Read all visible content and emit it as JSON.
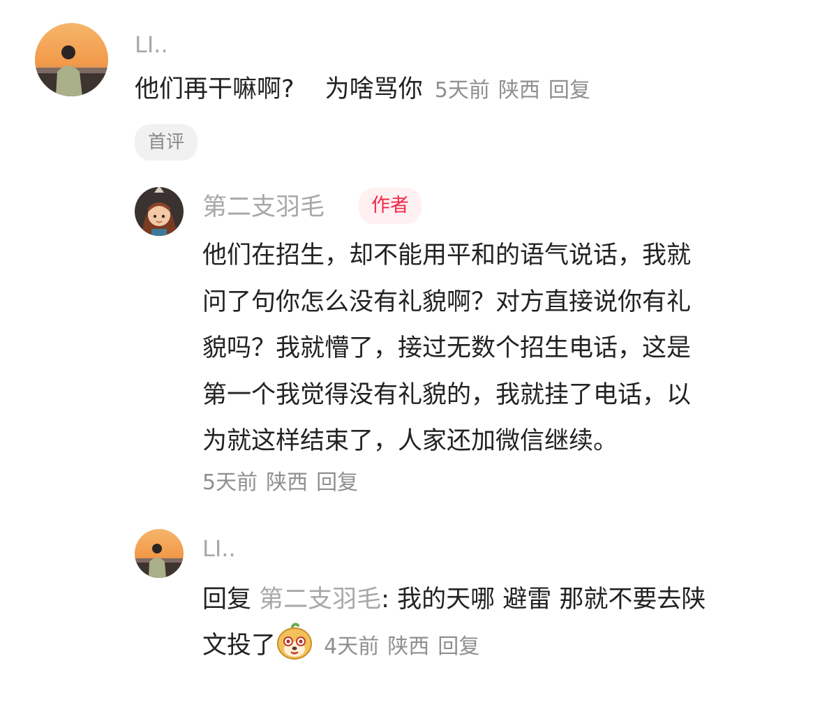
{
  "comment": {
    "username": "LI..",
    "text_part1": "他们再干嘛啊?",
    "text_part2": "为啥骂你",
    "time": "5天前",
    "location": "陕西",
    "reply_label": "回复",
    "tag": "首评",
    "avatar_icon": "sunset-silhouette-avatar"
  },
  "replies": [
    {
      "username": "第二支羽毛",
      "badge": "作者",
      "lines": [
        "他们在招生，却不能用平和的语气说话，我就",
        "问了句你怎么没有礼貌啊？对方直接说你有礼",
        "貌吗？我就懵了，接过无数个招生电话，这是",
        "第一个我觉得没有礼貌的，我就挂了电话，以",
        "为就这样结束了，人家还加微信继续。"
      ],
      "time": "5天前",
      "location": "陕西",
      "reply_label": "回复",
      "avatar_icon": "cartoon-girl-avatar"
    },
    {
      "username": "LI..",
      "reply_prefix": "回复",
      "reply_to": "第二支羽毛",
      "colon": ":",
      "line1_text": "我的天哪 避雷  那就不要去陕",
      "line2_text": "文投了",
      "sticker_icon": "cute-cartoon-sticker-icon",
      "time": "4天前",
      "location": "陕西",
      "reply_label": "回复",
      "avatar_icon": "sunset-silhouette-avatar"
    }
  ],
  "colors": {
    "name_gray": "#a8a8a8",
    "meta_gray": "#8f8f8f",
    "author_red": "#f0284a",
    "author_bg": "#fff0f2",
    "tag_bg": "#f1f1f1"
  }
}
